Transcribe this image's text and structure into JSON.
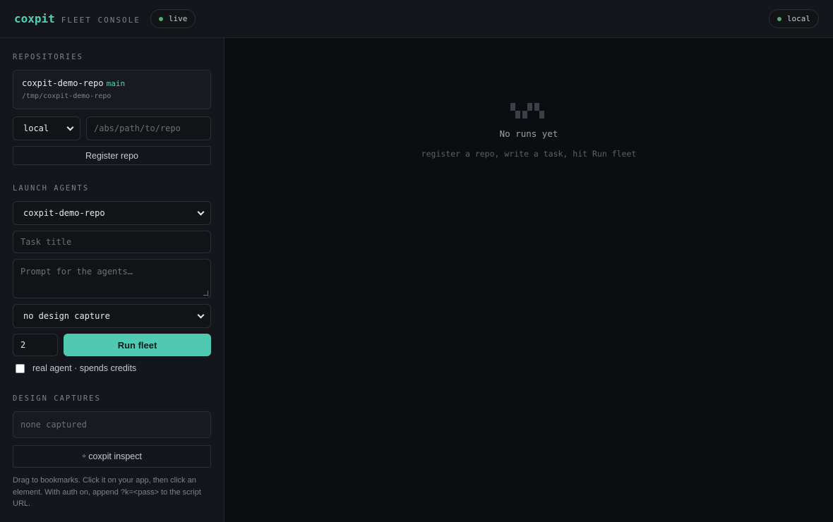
{
  "header": {
    "brand": "coxpit",
    "subtitle": "FLEET CONSOLE",
    "status_live": "live",
    "status_local": "local",
    "status_color": "#4caf6e",
    "accent_color": "#4fd1b5"
  },
  "sidebar": {
    "repositories": {
      "title": "REPOSITORIES",
      "repo": {
        "name": "coxpit-demo-repo",
        "branch": "main",
        "path": "/tmp/coxpit-demo-repo"
      },
      "location_select": "local",
      "path_placeholder": "/abs/path/to/repo",
      "register_button": "Register repo"
    },
    "launch": {
      "title": "LAUNCH AGENTS",
      "repo_select": "coxpit-demo-repo",
      "task_placeholder": "Task title",
      "prompt_placeholder": "Prompt for the agents…",
      "design_select": "no design capture",
      "agent_count": "2",
      "run_button": "Run fleet",
      "real_agent_label": "real agent · spends credits",
      "real_agent_checked": false
    },
    "design_captures": {
      "title": "DESIGN CAPTURES",
      "empty_text": "none captured",
      "inspect_icon": "crosshair-icon",
      "inspect_button": "coxpit inspect",
      "help_text": "Drag to bookmarks. Click it on your app, then click an element. With auth on, append ?k=<pass> to the script URL."
    }
  },
  "main": {
    "empty_icon": "runs-empty-icon",
    "empty_title": "No runs yet",
    "empty_subtitle": "register a repo, write a task, hit Run fleet"
  }
}
